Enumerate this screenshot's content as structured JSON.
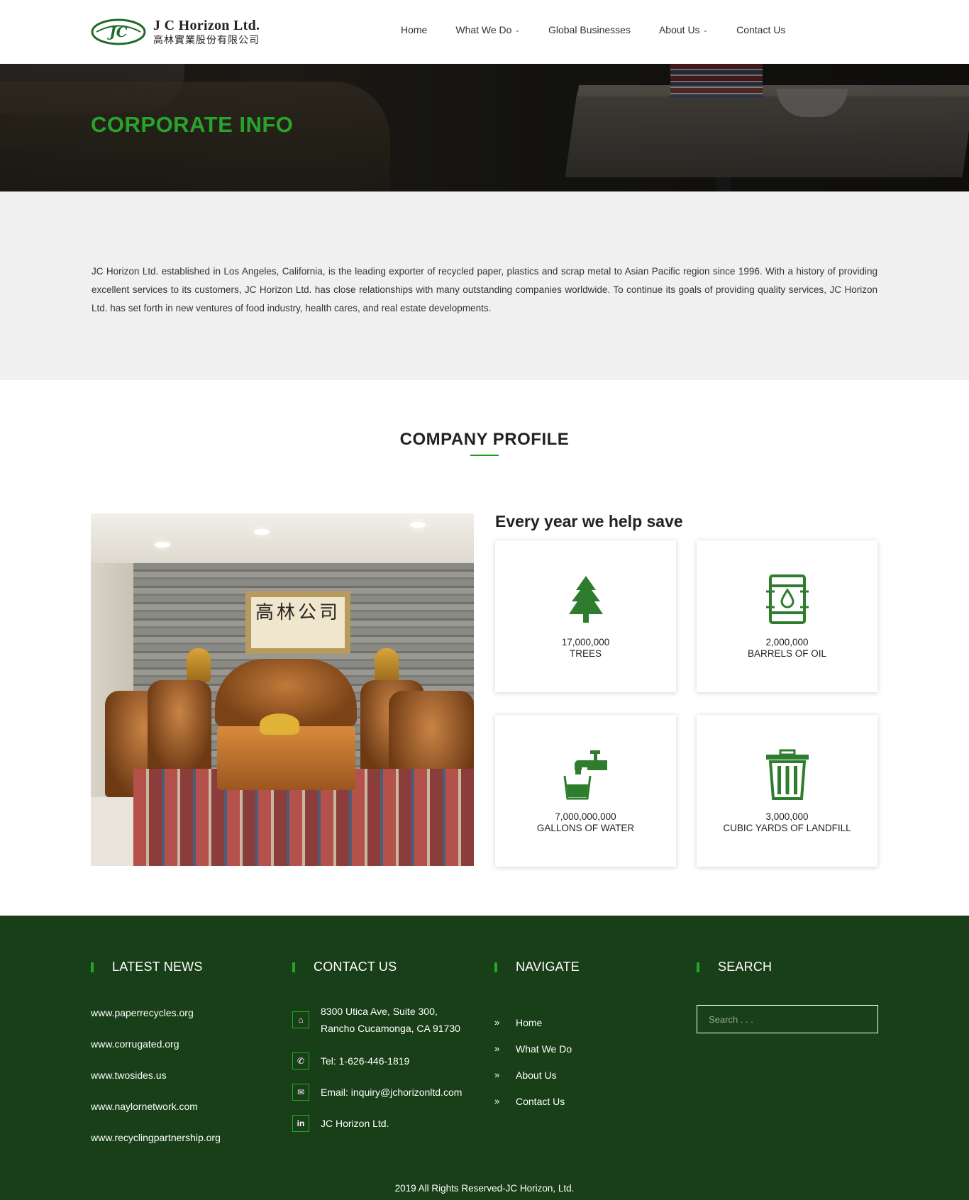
{
  "header": {
    "logo_initials": "JC",
    "company_name": "J C Horizon Ltd.",
    "company_name_cn": "高林實業股份有限公司",
    "nav": [
      {
        "label": "Home",
        "has_dropdown": false
      },
      {
        "label": "What We Do",
        "has_dropdown": true
      },
      {
        "label": "Global Businesses",
        "has_dropdown": false
      },
      {
        "label": "About Us",
        "has_dropdown": true
      },
      {
        "label": "Contact Us",
        "has_dropdown": false
      }
    ]
  },
  "hero": {
    "title": "CORPORATE INFO"
  },
  "intro": {
    "text": "JC Horizon Ltd. established in Los Angeles, California, is the leading exporter of recycled paper, plastics and scrap metal to Asian Pacific region since 1996. With a history of providing excellent services to its customers, JC Horizon Ltd. has close relationships with many outstanding companies worldwide. To continue its goals of providing quality services, JC Horizon Ltd. has set forth in new ventures of food industry, health cares, and real estate developments."
  },
  "profile": {
    "title": "COMPANY PROFILE",
    "photo_sign_text": "高林公司",
    "help_title": "Every year we help save",
    "stats": [
      {
        "icon": "tree-icon",
        "value": "17,000,000",
        "label": "TREES"
      },
      {
        "icon": "oil-barrel-icon",
        "value": "2,000,000",
        "label": "BARRELS OF OIL"
      },
      {
        "icon": "water-faucet-icon",
        "value": "7,000,000,000",
        "label": "GALLONS OF WATER"
      },
      {
        "icon": "trash-can-icon",
        "value": "3,000,000",
        "label": "CUBIC YARDS OF LANDFILL"
      }
    ]
  },
  "footer": {
    "news": {
      "title": "LATEST NEWS",
      "links": [
        "www.paperrecycles.org",
        "www.corrugated.org",
        "www.twosides.us",
        "www.naylornetwork.com",
        "www.recyclingpartnership.org"
      ]
    },
    "contact": {
      "title": "CONTACT US",
      "address_line1": "8300 Utica Ave, Suite 300,",
      "address_line2": "Rancho Cucamonga, CA 91730",
      "tel": "Tel: 1-626-446-1819",
      "email": "Email: inquiry@jchorizonltd.com",
      "linkedin": "JC Horizon Ltd."
    },
    "navigate": {
      "title": "NAVIGATE",
      "items": [
        "Home",
        "What We Do",
        "About Us",
        "Contact Us"
      ]
    },
    "search": {
      "title": "SEARCH",
      "placeholder": "Search . . ."
    },
    "copyright": "2019 All Rights Reserved-JC Horizon, Ltd."
  },
  "colors": {
    "brand_green": "#1a9c1a",
    "hero_title_green": "#29a329",
    "footer_bg": "#183f17",
    "icon_green": "#2e7d2e"
  }
}
